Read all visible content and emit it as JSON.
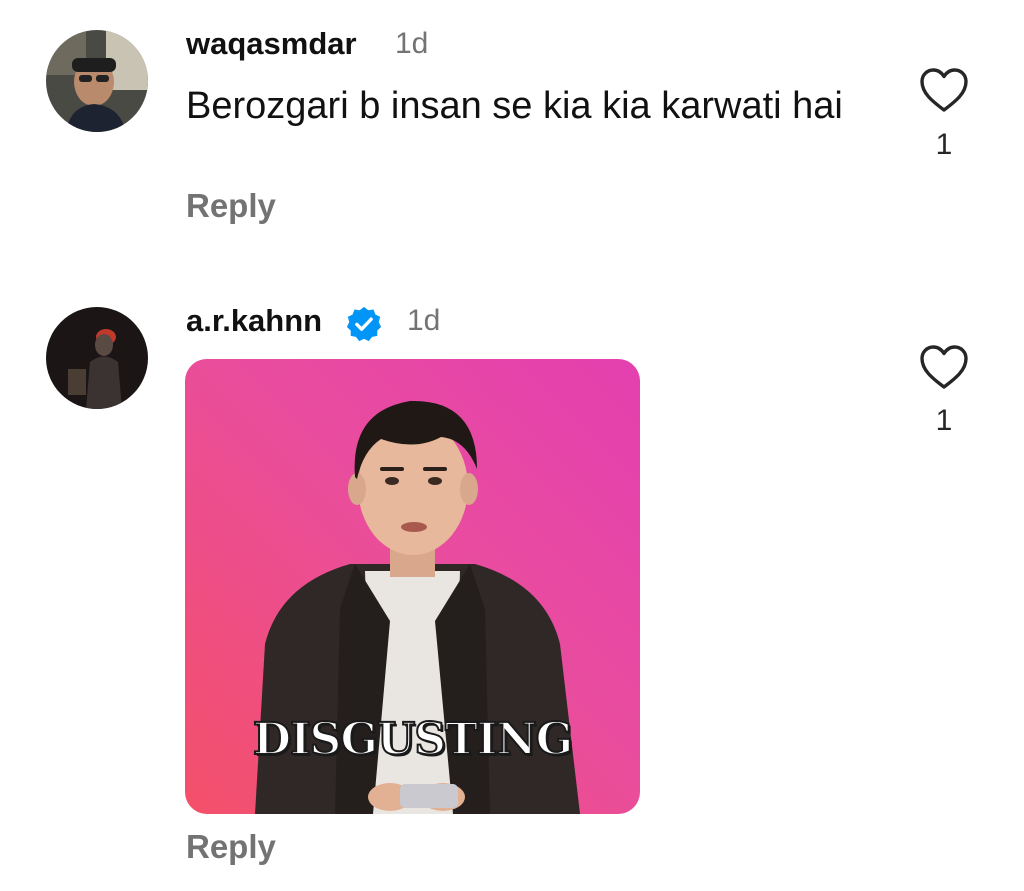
{
  "comments": [
    {
      "username": "waqasmdar",
      "time": "1d",
      "text": "Berozgari b insan se kia kia karwati hai",
      "likes": "1",
      "reply_label": "Reply",
      "verified": false,
      "avatar_icon": "profile-photo"
    },
    {
      "username": "a.r.kahnn",
      "time": "1d",
      "verified": true,
      "verified_icon": "verified-badge-icon",
      "gif_caption": "DISGUSTING",
      "likes": "1",
      "reply_label": "Reply",
      "avatar_icon": "profile-photo"
    }
  ],
  "colors": {
    "verified_blue": "#0095f6",
    "muted_text": "#737373",
    "gif_pink": "#e43fb0",
    "gif_coral": "#f4506a"
  },
  "icons": {
    "like": "heart-outline-icon"
  }
}
